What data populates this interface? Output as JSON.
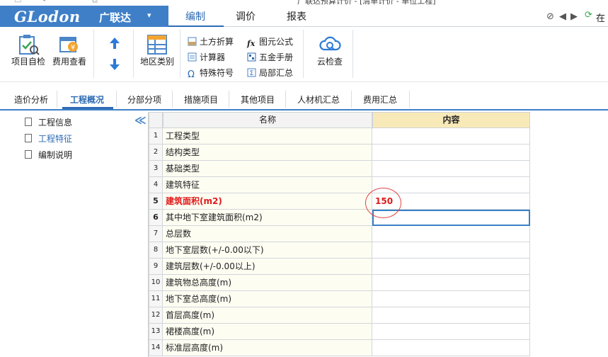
{
  "title_bar": {
    "document_title": "广联达预算计价 - [清单计价 - 单位工程]"
  },
  "brand": {
    "logo_text": "GLodon",
    "cn_name": "广联达",
    "caret": "▾"
  },
  "menu_tabs": [
    {
      "label": "编制",
      "active": true
    },
    {
      "label": "调价",
      "active": false
    },
    {
      "label": "报表",
      "active": false
    }
  ],
  "top_right": {
    "back": "⊘",
    "undo": "◀",
    "redo": "▶",
    "online_icon": "⟳",
    "online_label": "在"
  },
  "ribbon": {
    "project_check": "项目自检",
    "fee_view": "费用查看",
    "region_category": "地区类别",
    "earthwork": "土方折算",
    "calculator": "计算器",
    "special_symbol": "特殊符号",
    "figure_formula": "图元公式",
    "hardware_manual": "五金手册",
    "partial_summary": "局部汇总",
    "cloud_check": "云检查"
  },
  "sub_tabs": [
    {
      "label": "造价分析",
      "active": false
    },
    {
      "label": "工程概况",
      "active": true
    },
    {
      "label": "分部分项",
      "active": false
    },
    {
      "label": "措施项目",
      "active": false
    },
    {
      "label": "其他项目",
      "active": false
    },
    {
      "label": "人材机汇总",
      "active": false
    },
    {
      "label": "费用汇总",
      "active": false
    }
  ],
  "tree": [
    {
      "label": "工程信息",
      "selected": false
    },
    {
      "label": "工程特征",
      "selected": true
    },
    {
      "label": "编制说明",
      "selected": false
    }
  ],
  "collapse_icon": "≪",
  "table": {
    "headers": {
      "name": "名称",
      "content": "内容"
    },
    "rows": [
      {
        "no": "1",
        "name": "工程类型",
        "value": ""
      },
      {
        "no": "2",
        "name": "结构类型",
        "value": ""
      },
      {
        "no": "3",
        "name": "基础类型",
        "value": ""
      },
      {
        "no": "4",
        "name": "建筑特征",
        "value": ""
      },
      {
        "no": "5",
        "name": "建筑面积(m2)",
        "value": "150"
      },
      {
        "no": "6",
        "name": "其中地下室建筑面积(m2)",
        "value": ""
      },
      {
        "no": "7",
        "name": "总层数",
        "value": ""
      },
      {
        "no": "8",
        "name": "地下室层数(+/-0.00以下)",
        "value": ""
      },
      {
        "no": "9",
        "name": "建筑层数(+/-0.00以上)",
        "value": ""
      },
      {
        "no": "10",
        "name": "建筑物总高度(m)",
        "value": ""
      },
      {
        "no": "11",
        "name": "地下室总高度(m)",
        "value": ""
      },
      {
        "no": "12",
        "name": "首层高度(m)",
        "value": ""
      },
      {
        "no": "13",
        "name": "裙楼高度(m)",
        "value": ""
      },
      {
        "no": "14",
        "name": "标准层高度(m)",
        "value": ""
      }
    ]
  },
  "colors": {
    "brand_blue": "#3f7fc7",
    "accent_blue": "#2d6bb4",
    "header_gold": "#f8e9b8",
    "highlight_red": "#e01b1b"
  }
}
